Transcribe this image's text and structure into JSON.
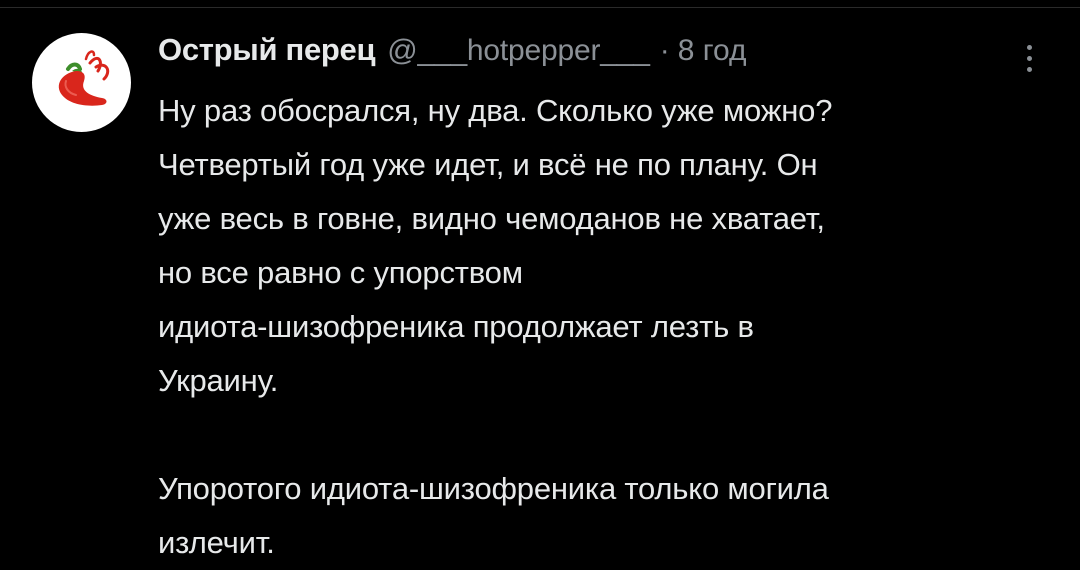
{
  "tweet": {
    "author": {
      "display_name": "Острый перец",
      "handle": "@___hotpepper___",
      "avatar_icon": "red-chili-pepper-icon"
    },
    "separator": "·",
    "timestamp": "8 год",
    "more_icon": "vertical-ellipsis-icon",
    "paragraph1": [
      "Ну раз обосрался, ну два. Сколько уже можно?",
      "Четвертый год уже идет, и всё не по плану. Он",
      "уже весь в говне, видно чемоданов не хватает,",
      "но все равно с упорством",
      "идиота-шизофреника продолжает лезть в",
      "Украину."
    ],
    "paragraph2": [
      "Упоротого идиота-шизофреника только могила",
      "излечит."
    ]
  },
  "colors": {
    "background": "#000000",
    "text_primary": "#e7e9ea",
    "text_secondary": "#8b9096",
    "pepper_red": "#d9261c",
    "pepper_green": "#3e8e2b"
  }
}
